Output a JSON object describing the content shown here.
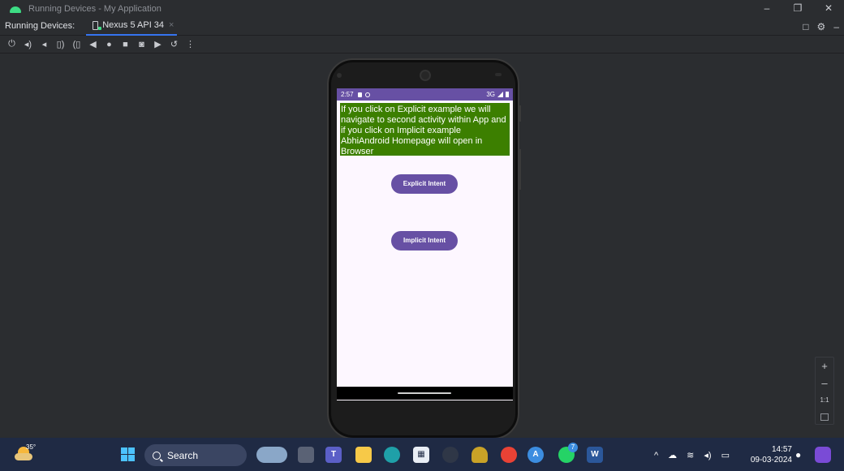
{
  "window": {
    "title": "Running Devices - My Application",
    "controls": [
      "–",
      "❐",
      "✕"
    ]
  },
  "tabbar": {
    "label": "Running Devices:",
    "tab_label": "Nexus 5 API 34",
    "tab_close": "×",
    "right_icons": [
      "□",
      "⚙",
      "–"
    ]
  },
  "toolbar": {
    "icons": [
      "power-icon",
      "volume-up-icon",
      "volume-down-icon",
      "rotate-left-icon",
      "rotate-right-icon",
      "back-icon",
      "home-icon",
      "overview-icon",
      "screenshot-icon",
      "screen-record-icon",
      "snapshot-icon",
      "more-icon"
    ],
    "glyphs": [
      "⏻",
      "◂)",
      "◂",
      "▯)",
      "(▯",
      "◀",
      "●",
      "■",
      "◙",
      "▶",
      "↺",
      "⋮"
    ]
  },
  "device": {
    "status_time": "2:57",
    "status_network": "3G",
    "info_text": "If you click on Explicit example we will navigate to second activity within App and if you click on Implicit example AbhiAndroid Homepage will open in Browser",
    "explicit_button": "Explicit Intent",
    "implicit_button": "Implicit Intent",
    "colors": {
      "primary": "#6750a4",
      "info_bg": "#3c7f00",
      "screen_bg": "#fdf7ff"
    }
  },
  "zoom": {
    "plus": "+",
    "minus": "–",
    "one_to_one": "1:1"
  },
  "taskbar": {
    "weather_temp": "35°",
    "search_placeholder": "Search",
    "apps": [
      "widgets-icon",
      "task-view-icon",
      "teams-icon",
      "file-explorer-icon",
      "edge-icon",
      "store-icon",
      "photos-icon",
      "medal-icon",
      "chrome-icon",
      "android-studio-icon",
      "whatsapp-icon",
      "word-icon"
    ],
    "whatsapp_badge": "7",
    "time": "14:57",
    "date": "09-03-2024"
  }
}
